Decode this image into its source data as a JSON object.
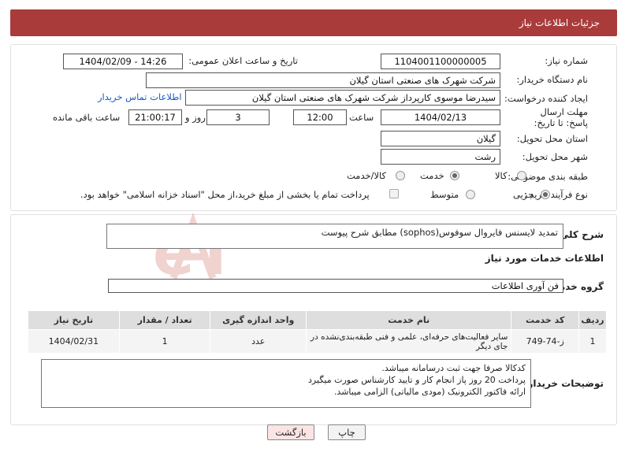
{
  "header": {
    "title": "جزئیات اطلاعات نیاز"
  },
  "form": {
    "need_number": {
      "label": "شماره نیاز:",
      "value": "1104001100000005"
    },
    "announce_datetime": {
      "label": "تاریخ و ساعت اعلان عمومی:",
      "value": "1404/02/09 - 14:26"
    },
    "buyer_org": {
      "label": "نام دستگاه خریدار:",
      "value": "شرکت شهرک های صنعتی استان گیلان"
    },
    "requester": {
      "label": "ایجاد کننده درخواست:",
      "value": "سیدرضا موسوی کارپرداز  شرکت شهرک های صنعتی استان گیلان",
      "contact_link": "اطلاعات تماس خریدار"
    },
    "deadline": {
      "label": "مهلت ارسال پاسخ: تا تاریخ:",
      "date": "1404/02/13",
      "time_label": "ساعت",
      "time": "12:00",
      "days": "3",
      "days_label": "روز و",
      "remaining": "21:00:17",
      "remaining_label": "ساعت باقی مانده"
    },
    "province": {
      "label": "استان محل تحویل:",
      "value": "گیلان"
    },
    "city": {
      "label": "شهر محل تحویل:",
      "value": "رشت"
    },
    "category": {
      "label": "طبقه بندی موضوعی:",
      "options": [
        "کالا",
        "خدمت",
        "کالا/خدمت"
      ],
      "selected": "خدمت"
    },
    "purchase_type": {
      "label": "نوع فرآیند خرید :",
      "options": [
        "جزیی",
        "متوسط"
      ],
      "selected": "جزیی",
      "payment_note": "پرداخت تمام یا بخشی از مبلغ خرید،از محل \"اسناد خزانه اسلامی\" خواهد بود."
    }
  },
  "details": {
    "summary_label": "شرح کلی نیاز:",
    "summary_value": "تمدید لایسنس فایروال سوفوس(sophos) مطابق شرح پیوست",
    "services_title": "اطلاعات خدمات مورد نیاز",
    "service_group_label": "گروه خدمت:",
    "service_group_value": "فن آوری اطلاعات",
    "table": {
      "headers": [
        "ردیف",
        "کد خدمت",
        "نام خدمت",
        "واحد اندازه گیری",
        "تعداد / مقدار",
        "تاریخ نیاز"
      ],
      "rows": [
        [
          "1",
          "ز-74-749",
          "سایر فعالیت‌های حرفه‌ای، علمی و فنی طبقه‌بندی‌نشده در جای دیگر",
          "عدد",
          "1",
          "1404/02/31"
        ]
      ]
    },
    "buyer_notes_label": "توضیحات خریدار:",
    "buyer_notes": [
      "کدکالا صرفا جهت ثبت درسامانه میباشد.",
      "پرداخت 20 روز پاز انجام کار و تایید کارشناس صورت میگیرد",
      "ارائه فاکتور الکترونیک (مودی مالیاتی) الزامی میباشد."
    ]
  },
  "footer": {
    "print_label": "چاپ",
    "back_label": "بازگشت"
  },
  "watermark": {
    "text": "AriaTender.neT",
    "color": "#c0392b"
  }
}
